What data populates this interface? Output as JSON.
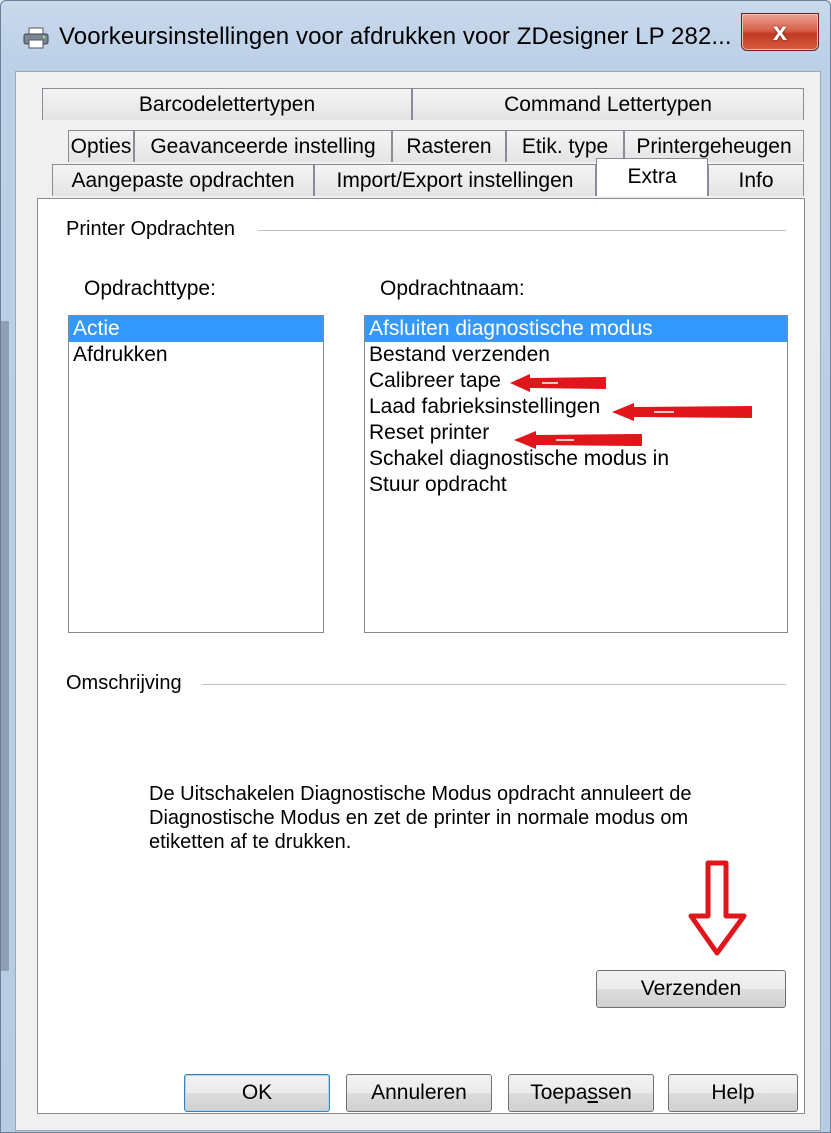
{
  "window": {
    "title": "Voorkeursinstellingen voor afdrukken voor ZDesigner LP 282...",
    "icon": "printer-icon",
    "close_label": "x"
  },
  "tabs": {
    "row1": [
      "Barcodelettertypen",
      "Command Lettertypen"
    ],
    "row2": [
      "Opties",
      "Geavanceerde instelling",
      "Rasteren",
      "Etik. type",
      "Printergeheugen"
    ],
    "row3": [
      "Aangepaste opdrachten",
      "Import/Export instellingen",
      "Extra",
      "Info"
    ],
    "active": "Extra"
  },
  "printer_opdrachten": {
    "group_label": "Printer Opdrachten",
    "type_label": "Opdrachttype:",
    "name_label": "Opdrachtnaam:",
    "types": [
      {
        "label": "Actie",
        "selected": true
      },
      {
        "label": "Afdrukken",
        "selected": false
      }
    ],
    "names": [
      {
        "label": "Afsluiten diagnostische modus",
        "selected": true
      },
      {
        "label": "Bestand verzenden",
        "selected": false
      },
      {
        "label": "Calibreer tape",
        "selected": false
      },
      {
        "label": "Laad fabrieksinstellingen",
        "selected": false
      },
      {
        "label": "Reset printer",
        "selected": false
      },
      {
        "label": "Schakel diagnostische modus in",
        "selected": false
      },
      {
        "label": "Stuur opdracht",
        "selected": false
      }
    ]
  },
  "omschrijving": {
    "group_label": "Omschrijving",
    "text": "De Uitschakelen Diagnostische Modus opdracht annuleert de Diagnostische Modus en zet de printer in normale modus om etiketten af te drukken."
  },
  "send_button": "Verzenden",
  "footer": {
    "ok": "OK",
    "cancel": "Annuleren",
    "apply_pre": "Toepa",
    "apply_u": "s",
    "apply_post": "sen",
    "help": "Help"
  },
  "colors": {
    "annotation": "#e0161b",
    "selection": "#3399ff"
  }
}
